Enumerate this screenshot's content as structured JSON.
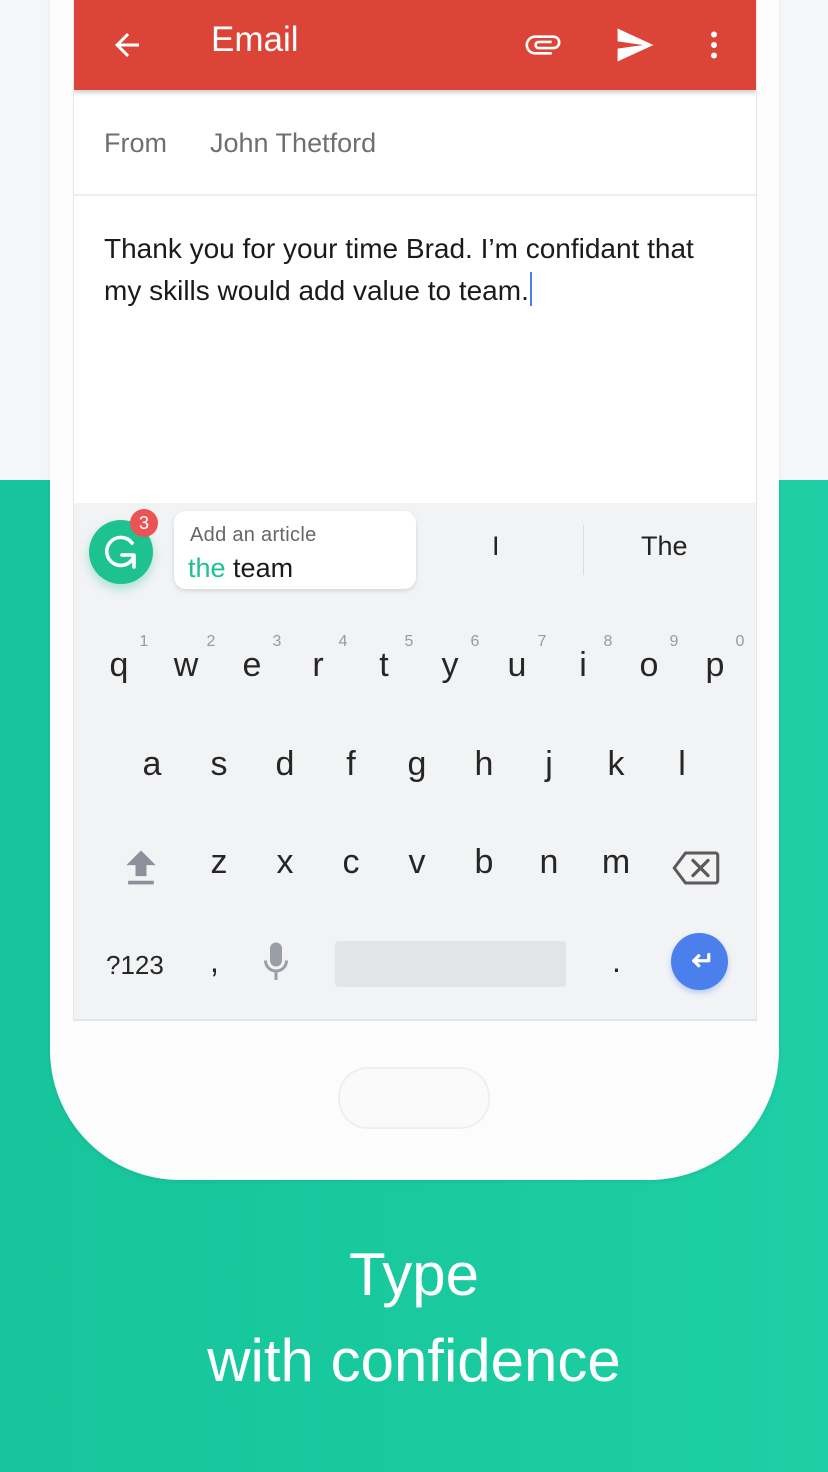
{
  "app_bar": {
    "title": "Email",
    "icons": [
      "back-arrow-icon",
      "paperclip-icon",
      "send-icon",
      "more-vert-icon"
    ],
    "color": "#db4437"
  },
  "compose": {
    "from_label": "From",
    "from_value": "John Thetford",
    "body": "Thank you for your time Brad. I’m confidant that my skills would add value to team."
  },
  "grammarly": {
    "badge_count": "3",
    "suggestion_hint": "Add an article",
    "suggestion_insert": "the",
    "suggestion_rest": " team",
    "accent_color": "#1ec291"
  },
  "word_suggestions": [
    "I",
    "The"
  ],
  "keyboard": {
    "row1": [
      {
        "key": "q",
        "hint": "1"
      },
      {
        "key": "w",
        "hint": "2"
      },
      {
        "key": "e",
        "hint": "3"
      },
      {
        "key": "r",
        "hint": "4"
      },
      {
        "key": "t",
        "hint": "5"
      },
      {
        "key": "y",
        "hint": "6"
      },
      {
        "key": "u",
        "hint": "7"
      },
      {
        "key": "i",
        "hint": "8"
      },
      {
        "key": "o",
        "hint": "9"
      },
      {
        "key": "p",
        "hint": "0"
      }
    ],
    "row2": [
      "a",
      "s",
      "d",
      "f",
      "g",
      "h",
      "j",
      "k",
      "l"
    ],
    "row3": [
      "z",
      "x",
      "c",
      "v",
      "b",
      "n",
      "m"
    ],
    "symbols_label": "?123",
    "comma": ",",
    "period": ".",
    "enter_color": "#4a7fec"
  },
  "tagline": {
    "line1": "Type",
    "line2": "with confidence"
  }
}
